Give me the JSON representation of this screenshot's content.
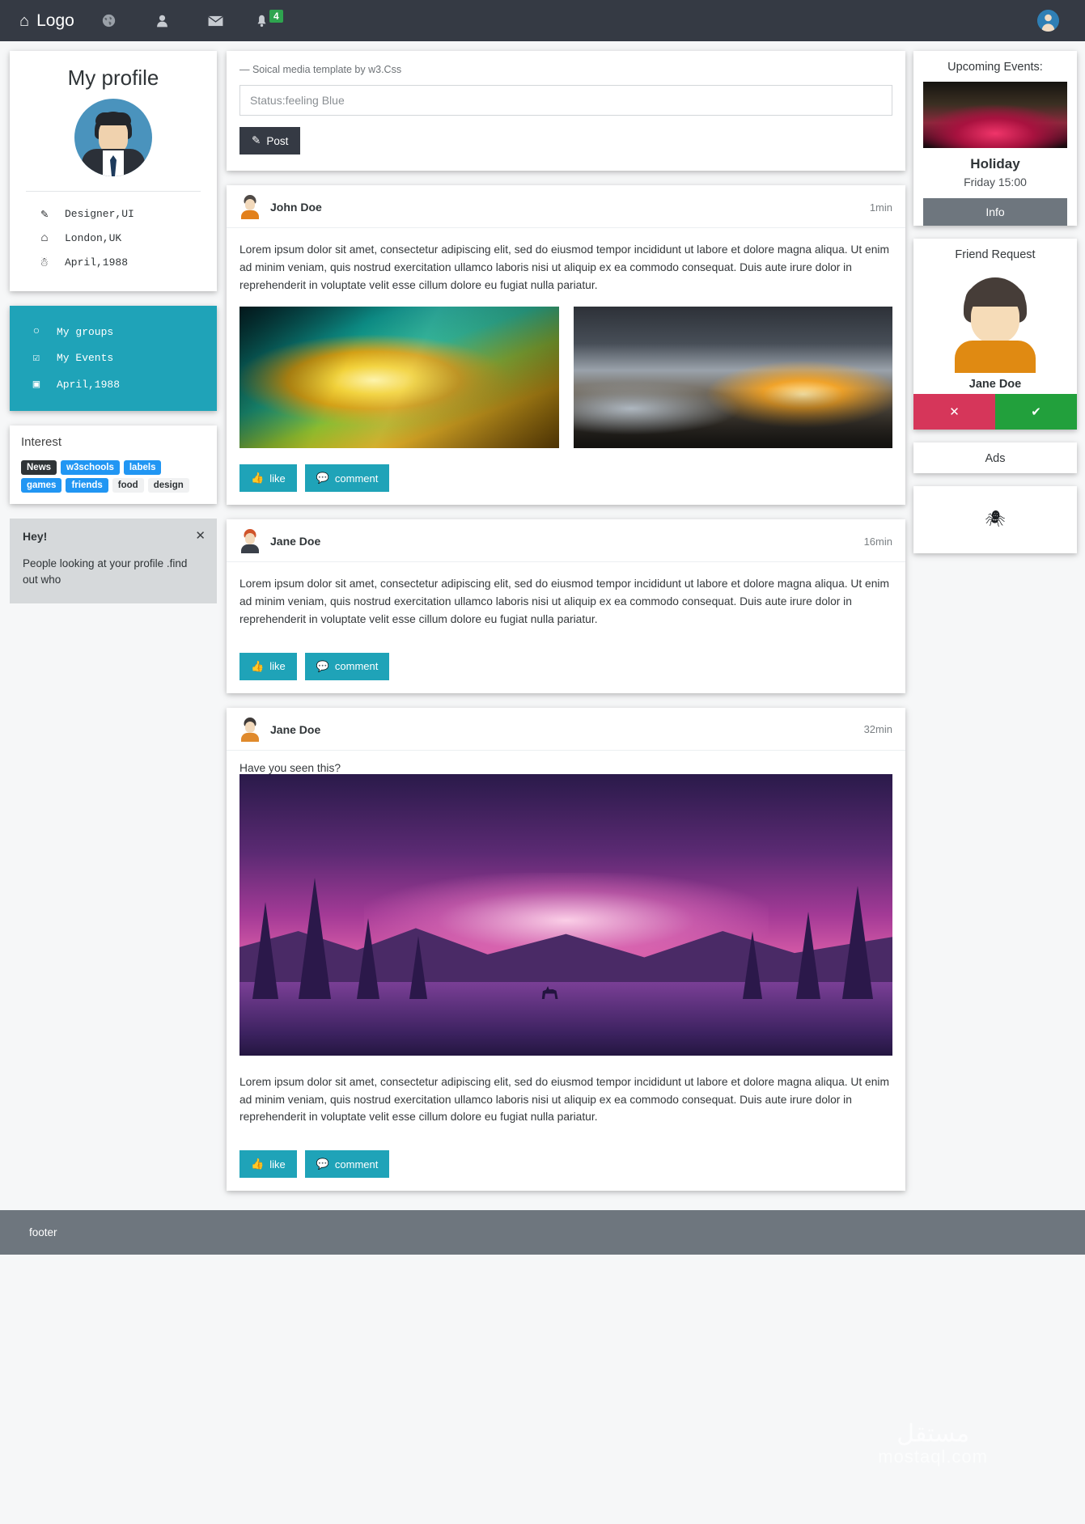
{
  "navbar": {
    "brand": "Logo",
    "brand_icon": "home-icon",
    "items": [
      {
        "name": "globe-icon",
        "glyph": "🌐"
      },
      {
        "name": "user-icon",
        "glyph": "👤"
      },
      {
        "name": "envelope-icon",
        "glyph": "✉"
      },
      {
        "name": "bell-icon",
        "glyph": "🔔",
        "badge": "4"
      }
    ],
    "badge_color": "#2ea44f",
    "bg_color": "#353a44"
  },
  "profile": {
    "title": "My profile",
    "info": [
      {
        "icon": "pencil-icon",
        "glyph": "✎",
        "text": "Designer,UI"
      },
      {
        "icon": "home-icon",
        "glyph": "⌂",
        "text": "London,UK"
      },
      {
        "icon": "birthday-cake-icon",
        "glyph": "☘",
        "text": "April,1988"
      }
    ]
  },
  "menu": {
    "accent": "#1fa3b8",
    "items": [
      {
        "icon": "circle-icon",
        "glyph": "○",
        "label": "My  groups"
      },
      {
        "icon": "calendar-check-icon",
        "glyph": "☑",
        "label": "My  Events"
      },
      {
        "icon": "image-icon",
        "glyph": "▣",
        "label": "April,1988"
      }
    ]
  },
  "interest": {
    "title": "Interest",
    "tags": [
      {
        "label": "News",
        "style": "dark"
      },
      {
        "label": "w3schools",
        "style": "blue"
      },
      {
        "label": "labels",
        "style": "blue"
      },
      {
        "label": "games",
        "style": "blue"
      },
      {
        "label": "friends",
        "style": "blue"
      },
      {
        "label": "food",
        "style": "light"
      },
      {
        "label": "design",
        "style": "light"
      }
    ]
  },
  "alert": {
    "heading": "Hey!",
    "body": "People looking at your profile .find out who",
    "close_glyph": "✕"
  },
  "composer": {
    "note": "— Soical media template by w3.Css",
    "placeholder": "Status:feeling Blue",
    "value": "",
    "post_label": "Post",
    "post_icon": "pencil-icon",
    "post_glyph": "✎"
  },
  "posts": [
    {
      "author": "John Doe",
      "time": "1min",
      "avatar": "av-john",
      "body": "Lorem ipsum dolor sit amet, consectetur adipiscing elit, sed do eiusmod tempor incididunt ut labore et dolore magna aliqua. Ut enim ad minim veniam, quis nostrud exercitation ullamco laboris nisi ut aliquip ex ea commodo consequat. Duis aute irure dolor in reprehenderit in voluptate velit esse cillum dolore eu fugiat nulla pariatur.",
      "caption": "",
      "images": [
        "aurora-wallpaper",
        "stormy-sunset-landscape"
      ],
      "like_label": "like",
      "comment_label": "comment"
    },
    {
      "author": "Jane Doe",
      "time": "16min",
      "avatar": "av-jane2",
      "body": "Lorem ipsum dolor sit amet, consectetur adipiscing elit, sed do eiusmod tempor incididunt ut labore et dolore magna aliqua. Ut enim ad minim veniam, quis nostrud exercitation ullamco laboris nisi ut aliquip ex ea commodo consequat. Duis aute irure dolor in reprehenderit in voluptate velit esse cillum dolore eu fugiat nulla pariatur.",
      "caption": "",
      "images": [],
      "like_label": "like",
      "comment_label": "comment"
    },
    {
      "author": "Jane Doe",
      "time": "32min",
      "avatar": "av-jane3",
      "caption": "Have you seen this?",
      "body": "Lorem ipsum dolor sit amet, consectetur adipiscing elit, sed do eiusmod tempor incididunt ut labore et dolore magna aliqua. Ut enim ad minim veniam, quis nostrud exercitation ullamco laboris nisi ut aliquip ex ea commodo consequat. Duis aute irure dolor in reprehenderit in voluptate velit esse cillum dolore eu fugiat nulla pariatur.",
      "images": [
        "purple-night-forest-lake"
      ],
      "like_label": "like",
      "comment_label": "comment"
    }
  ],
  "right": {
    "events_title": "Upcoming Events:",
    "event_name": "Holiday",
    "event_time": "Friday 15:00",
    "info_label": "Info",
    "friend_request_title": "Friend Request",
    "friend_name": "Jane Doe",
    "deny_glyph": "✕",
    "accept_glyph": "✔",
    "deny_color": "#d6365a",
    "accept_color": "#22a03c",
    "ads_title": "Ads",
    "ads_icon_glyph": "🕷"
  },
  "footer": {
    "text": "footer"
  },
  "watermark": {
    "line1": "مستقل",
    "line2": "mostaql.com"
  }
}
